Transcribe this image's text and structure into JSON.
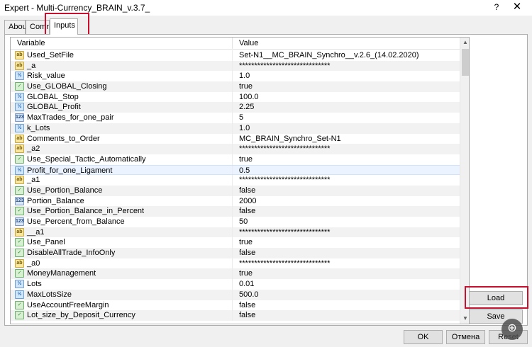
{
  "window": {
    "title": "Expert - Multi-Currency_BRAIN_v.3.7_",
    "help_label": "?",
    "close_label": "✕"
  },
  "tabs": [
    {
      "label": "About"
    },
    {
      "label": "Common"
    },
    {
      "label": "Inputs"
    }
  ],
  "grid": {
    "col_variable": "Variable",
    "col_value": "Value",
    "rows": [
      {
        "icon": "ab",
        "variable": "Used_SetFile",
        "value": "Set-N1__MC_BRAIN_Synchro__v.2.6_(14.02.2020)"
      },
      {
        "icon": "ab",
        "variable": "_a",
        "value": "******************************"
      },
      {
        "icon": "num",
        "variable": "Risk_value",
        "value": "1.0"
      },
      {
        "icon": "bool",
        "variable": "Use_GLOBAL_Closing",
        "value": "true"
      },
      {
        "icon": "num",
        "variable": "GLOBAL_Stop",
        "value": "100.0"
      },
      {
        "icon": "num",
        "variable": "GLOBAL_Profit",
        "value": "2.25"
      },
      {
        "icon": "int",
        "variable": "MaxTrades_for_one_pair",
        "value": "5"
      },
      {
        "icon": "num",
        "variable": "k_Lots",
        "value": "1.0"
      },
      {
        "icon": "ab",
        "variable": "Comments_to_Order",
        "value": "MC_BRAIN_Synchro_Set-N1"
      },
      {
        "icon": "ab",
        "variable": "_a2",
        "value": "******************************"
      },
      {
        "icon": "bool",
        "variable": "Use_Special_Tactic_Automatically",
        "value": "true"
      },
      {
        "icon": "num",
        "variable": "Profit_for_one_Ligament",
        "value": "0.5"
      },
      {
        "icon": "ab",
        "variable": "_a1",
        "value": "******************************"
      },
      {
        "icon": "bool",
        "variable": "Use_Portion_Balance",
        "value": "false"
      },
      {
        "icon": "int",
        "variable": "Portion_Balance",
        "value": "2000"
      },
      {
        "icon": "bool",
        "variable": "Use_Portion_Balance_in_Percent",
        "value": "false"
      },
      {
        "icon": "int",
        "variable": "Use_Percent_from_Balance",
        "value": "50"
      },
      {
        "icon": "ab",
        "variable": "__a1",
        "value": "******************************"
      },
      {
        "icon": "bool",
        "variable": "Use_Panel",
        "value": "true"
      },
      {
        "icon": "bool",
        "variable": "DisableAllTrade_InfoOnly",
        "value": "false"
      },
      {
        "icon": "ab",
        "variable": "_a0",
        "value": "******************************"
      },
      {
        "icon": "bool",
        "variable": "MoneyManagement",
        "value": "true"
      },
      {
        "icon": "num",
        "variable": "Lots",
        "value": "0.01"
      },
      {
        "icon": "num",
        "variable": "MaxLotsSize",
        "value": "500.0"
      },
      {
        "icon": "bool",
        "variable": "UseAccountFreeMargin",
        "value": "false"
      },
      {
        "icon": "bool",
        "variable": "Lot_size_by_Deposit_Currency",
        "value": "false"
      }
    ]
  },
  "icon_glyphs": {
    "ab": "ab",
    "num": "½",
    "bool": "✓",
    "int": "123"
  },
  "icon_names": {
    "ab": "string-type-icon",
    "num": "double-type-icon",
    "bool": "bool-type-icon",
    "int": "integer-type-icon"
  },
  "buttons": {
    "load": "Load",
    "save": "Save",
    "ok": "OK",
    "cancel": "Отмена",
    "reset": "Reset"
  },
  "colors": {
    "highlight": "#c8102e",
    "selected_row": "#eaf3ff"
  }
}
